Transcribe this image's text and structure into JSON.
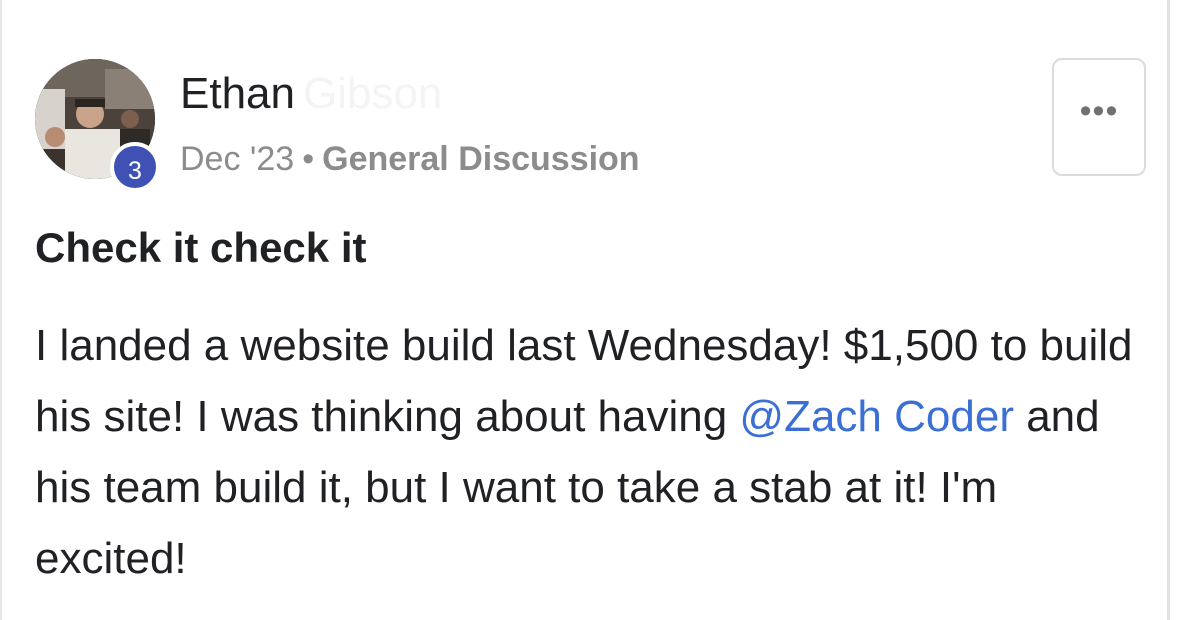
{
  "post": {
    "author": {
      "first_name": "Ethan",
      "last_name": "Gibson",
      "level": "3"
    },
    "meta": {
      "date": "Dec '23",
      "separator": "•",
      "category": "General Discussion"
    },
    "menu": {
      "more_label": "•••"
    },
    "title": "Check it check it",
    "body": {
      "before_mention": "I landed a website build last Wednesday! $1,500 to build his site! I was thinking about having ",
      "mention": "@Zach Coder",
      "after_mention": " and his team build it, but I want to take a stab at it! I'm excited!"
    }
  },
  "colors": {
    "badge": "#3f51b5",
    "mention": "#3b6fd6",
    "meta_text": "#8c8c8c",
    "primary_text": "#202124"
  },
  "icons": {
    "more": "more-horizontal-icon",
    "avatar": "user-avatar-photo"
  }
}
